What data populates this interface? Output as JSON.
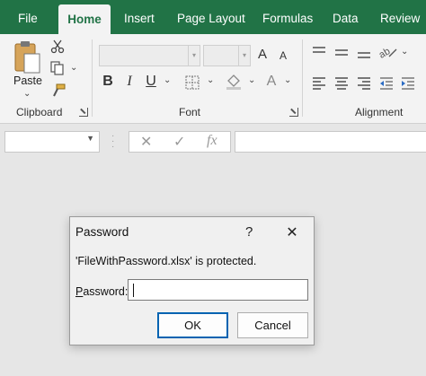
{
  "tabs": [
    {
      "label": "File",
      "active": false
    },
    {
      "label": "Home",
      "active": true
    },
    {
      "label": "Insert",
      "active": false
    },
    {
      "label": "Page Layout",
      "active": false
    },
    {
      "label": "Formulas",
      "active": false
    },
    {
      "label": "Data",
      "active": false
    },
    {
      "label": "Review",
      "active": false
    }
  ],
  "ribbon": {
    "clipboard": {
      "paste_label": "Paste",
      "group_label": "Clipboard"
    },
    "font": {
      "bold": "B",
      "italic": "I",
      "underline": "U",
      "grow": "A",
      "shrink": "A",
      "color": "A",
      "group_label": "Font"
    },
    "alignment": {
      "group_label": "Alignment"
    }
  },
  "formula_bar": {
    "fx": "fx",
    "cancel_glyph": "✕",
    "enter_glyph": "✓"
  },
  "dialog": {
    "title": "Password",
    "help": "?",
    "close": "✕",
    "message": "'FileWithPassword.xlsx' is protected.",
    "password_label_accel": "P",
    "password_label_rest": "assword:",
    "password_value": "",
    "ok_label": "OK",
    "cancel_label": "Cancel"
  },
  "colors": {
    "accent": "#217346",
    "ribbon_bg": "#f3f3f3",
    "workspace_bg": "#e6e6e6",
    "dialog_border_focus": "#0063b1"
  }
}
